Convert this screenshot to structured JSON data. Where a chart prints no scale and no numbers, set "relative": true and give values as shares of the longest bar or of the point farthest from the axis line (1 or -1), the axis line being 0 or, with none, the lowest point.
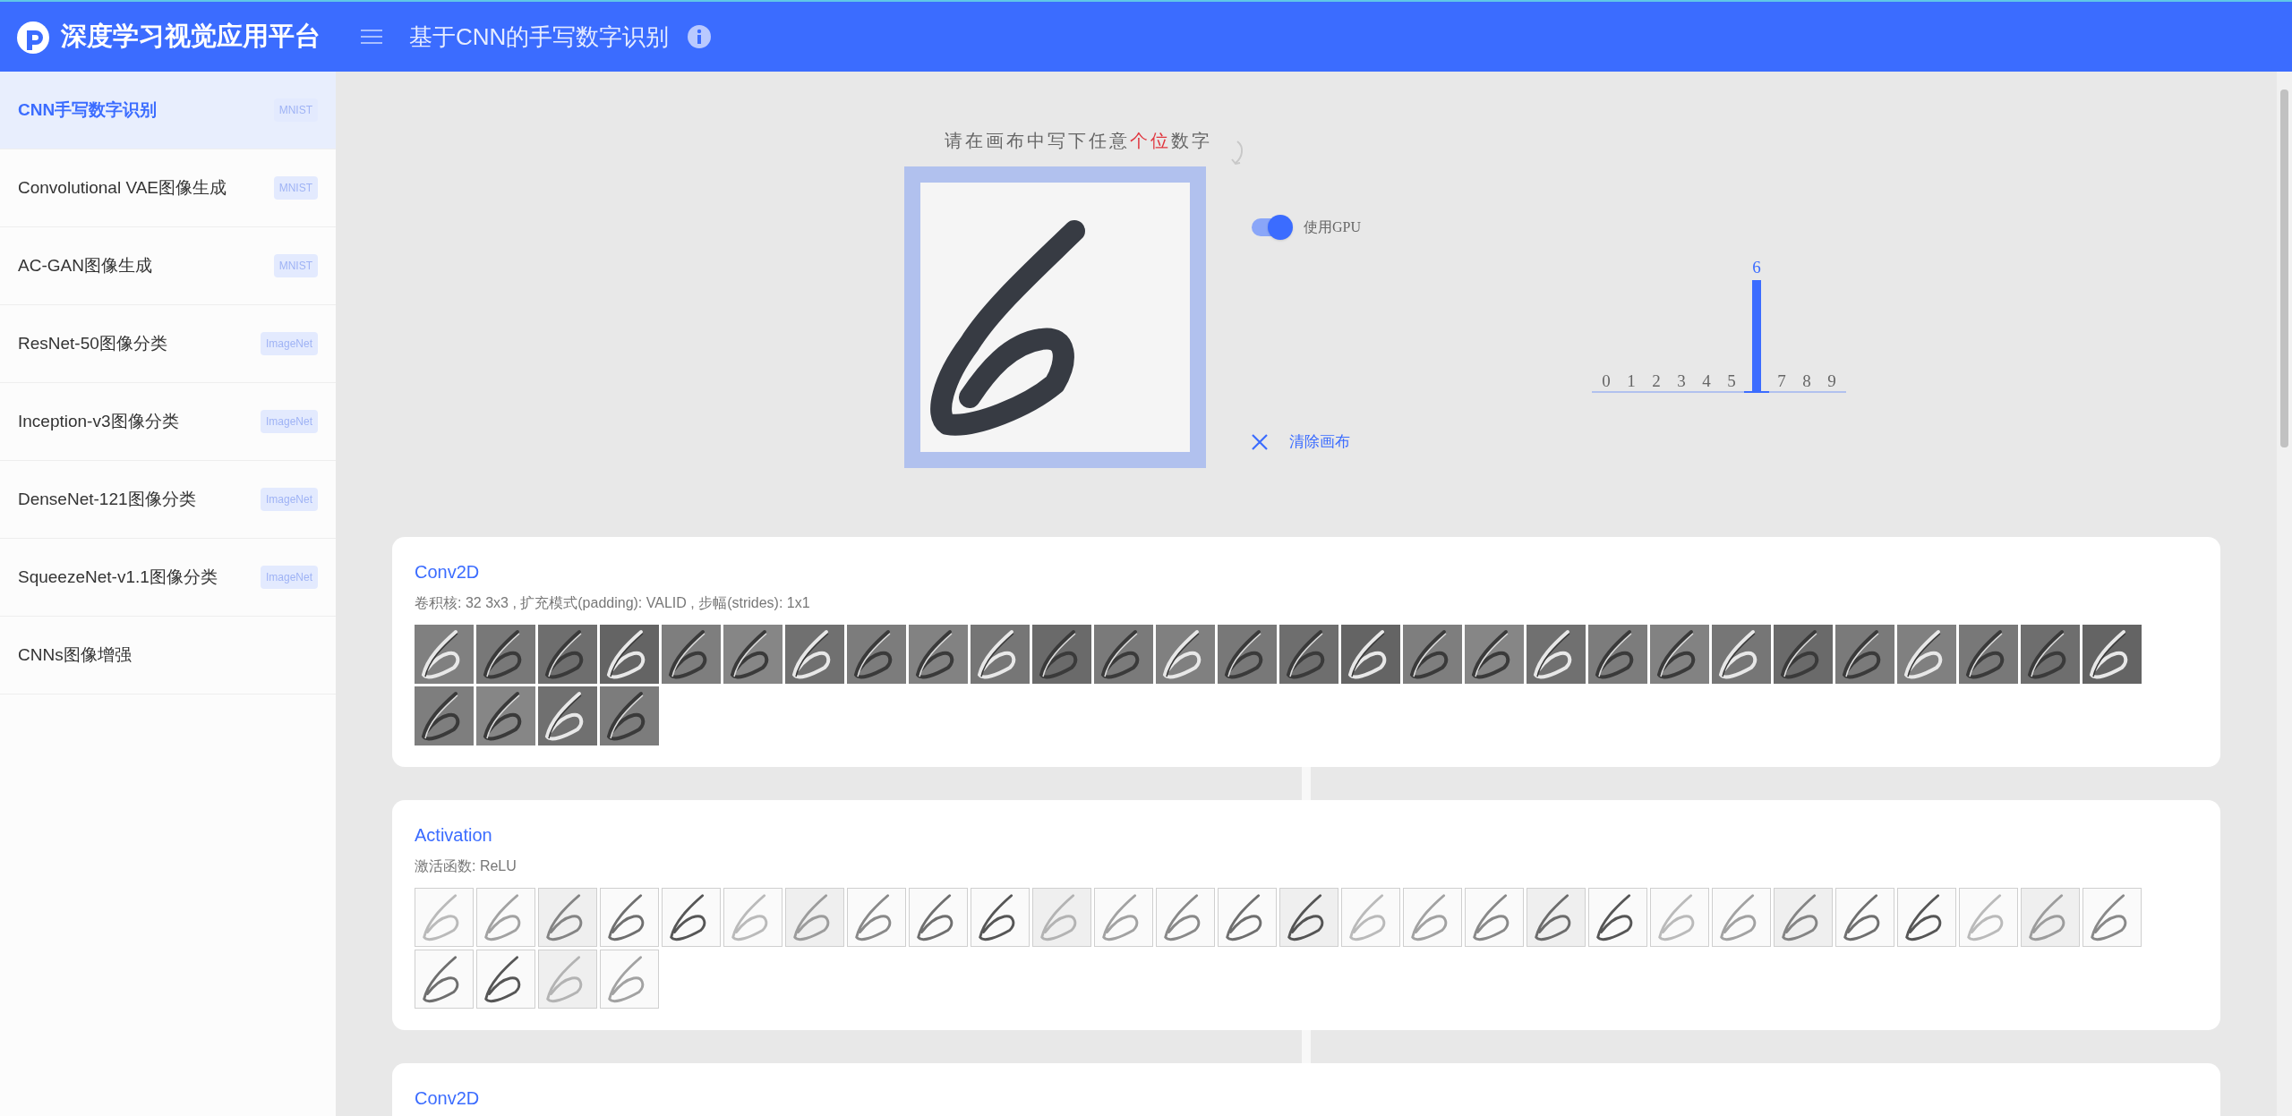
{
  "header": {
    "app_title": "深度学习视觉应用平台",
    "page_title": "基于CNN的手写数字识别"
  },
  "sidebar": {
    "items": [
      {
        "label": "CNN手写数字识别",
        "badge": "MNIST",
        "selected": true
      },
      {
        "label": "Convolutional VAE图像生成",
        "badge": "MNIST",
        "selected": false
      },
      {
        "label": "AC-GAN图像生成",
        "badge": "MNIST",
        "selected": false
      },
      {
        "label": "ResNet-50图像分类",
        "badge": "ImageNet",
        "selected": false
      },
      {
        "label": "Inception-v3图像分类",
        "badge": "ImageNet",
        "selected": false
      },
      {
        "label": "DenseNet-121图像分类",
        "badge": "ImageNet",
        "selected": false
      },
      {
        "label": "SqueezeNet-v1.1图像分类",
        "badge": "ImageNet",
        "selected": false
      },
      {
        "label": "CNNs图像增强",
        "selected": false
      }
    ]
  },
  "drawing": {
    "prompt": [
      {
        "text": "请在画布中写下任意",
        "highlight": false
      },
      {
        "text": "个位",
        "highlight": true
      },
      {
        "text": "数字",
        "highlight": false
      }
    ],
    "gpu_toggle": {
      "label": "使用GPU",
      "on": true
    },
    "clear_button": "清除画布"
  },
  "prediction": {
    "chart_data": {
      "type": "bar",
      "relative": true,
      "categories": [
        "0",
        "1",
        "2",
        "3",
        "4",
        "5",
        "6",
        "7",
        "8",
        "9"
      ],
      "values": [
        0,
        0,
        0,
        0,
        0,
        0,
        1,
        0,
        0,
        0
      ]
    }
  },
  "layers": [
    {
      "kind": "conv",
      "title": "Conv2D",
      "description": "卷积核: 32 3x3 , 扩充模式(padding): VALID , 步幅(strides): 1x1"
    },
    {
      "kind": "activation",
      "title": "Activation",
      "description": "激活函数: ReLU"
    },
    {
      "kind": "conv",
      "title": "Conv2D"
    }
  ]
}
